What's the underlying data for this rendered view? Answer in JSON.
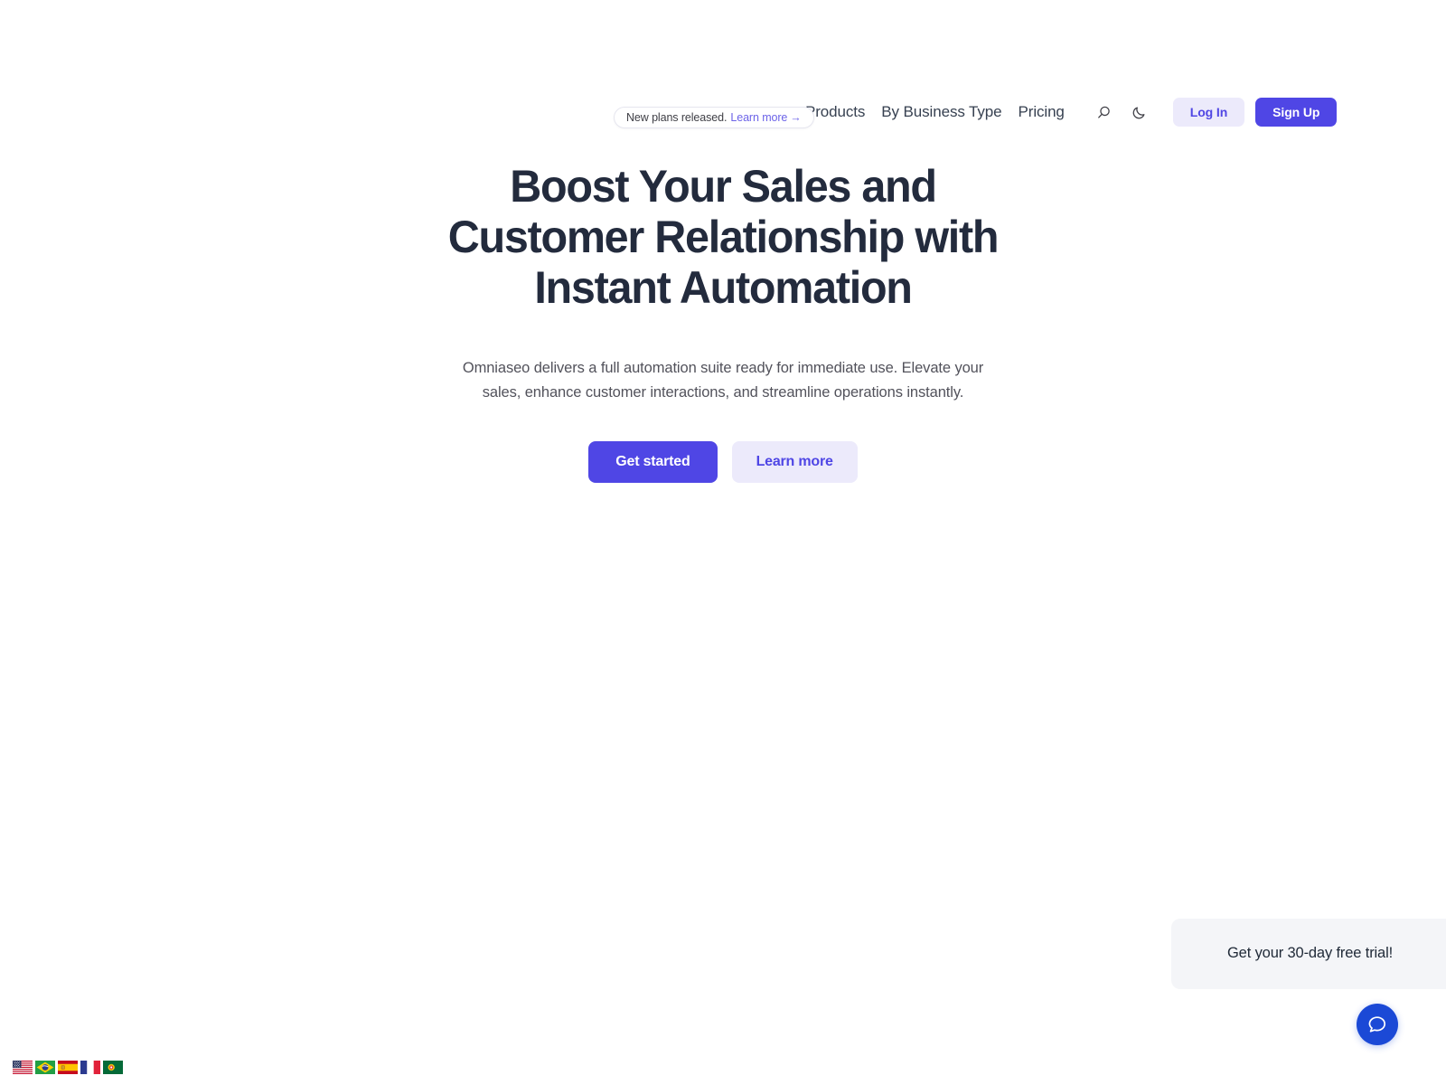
{
  "announcement": {
    "text": "New plans released.",
    "link_label": "Learn more",
    "arrow": "→"
  },
  "nav": {
    "links": [
      {
        "label": "Products"
      },
      {
        "label": "By Business Type"
      },
      {
        "label": "Pricing"
      }
    ],
    "search_icon": "search-icon",
    "theme_icon": "moon-icon",
    "login_label": "Log In",
    "signup_label": "Sign Up"
  },
  "hero": {
    "title": "Boost Your Sales and Customer Relationship with Instant Automation",
    "subtitle": "Omniaseo delivers a full automation suite ready for immediate use. Elevate your sales, enhance customer interactions, and streamline operations instantly.",
    "primary_cta": "Get started",
    "secondary_cta": "Learn more"
  },
  "chat": {
    "teaser": "Get your 30-day free trial!",
    "fab_icon": "chat-bubble-icon"
  },
  "language_switcher": {
    "flags": [
      {
        "code": "en",
        "name": "united-states-flag"
      },
      {
        "code": "pt-br",
        "name": "brazil-flag"
      },
      {
        "code": "es",
        "name": "spain-flag"
      },
      {
        "code": "fr",
        "name": "france-flag"
      },
      {
        "code": "pt",
        "name": "portugal-flag"
      }
    ]
  },
  "colors": {
    "brand_indigo": "#4f46e5",
    "brand_indigo_soft": "#eceafb",
    "chat_blue": "#1b49d6",
    "heading": "#232b3d",
    "body_text": "#52525b",
    "teaser_bg": "#f4f5f8"
  }
}
